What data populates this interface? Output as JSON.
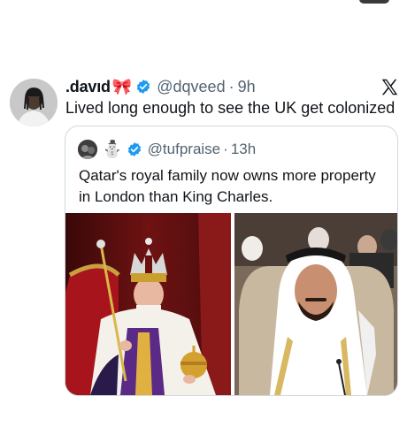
{
  "tweet": {
    "display_name": ".davıd",
    "name_emoji": "🎀",
    "handle": "@dqveed",
    "separator": "·",
    "time": "9h",
    "text": "Lived long enough to see the UK get colonized"
  },
  "quoted_tweet": {
    "name_emoji": "⛄",
    "handle": "@tufpraise",
    "separator": "·",
    "time": "13h",
    "text": "Qatar's royal family now owns more property in London than King Charles."
  },
  "icons": {
    "verified": "verified-badge-icon",
    "platform": "x-logo-icon"
  },
  "colors": {
    "verified_blue": "#1d9bf0",
    "secondary_text": "#536471",
    "border": "#cfd9de"
  }
}
